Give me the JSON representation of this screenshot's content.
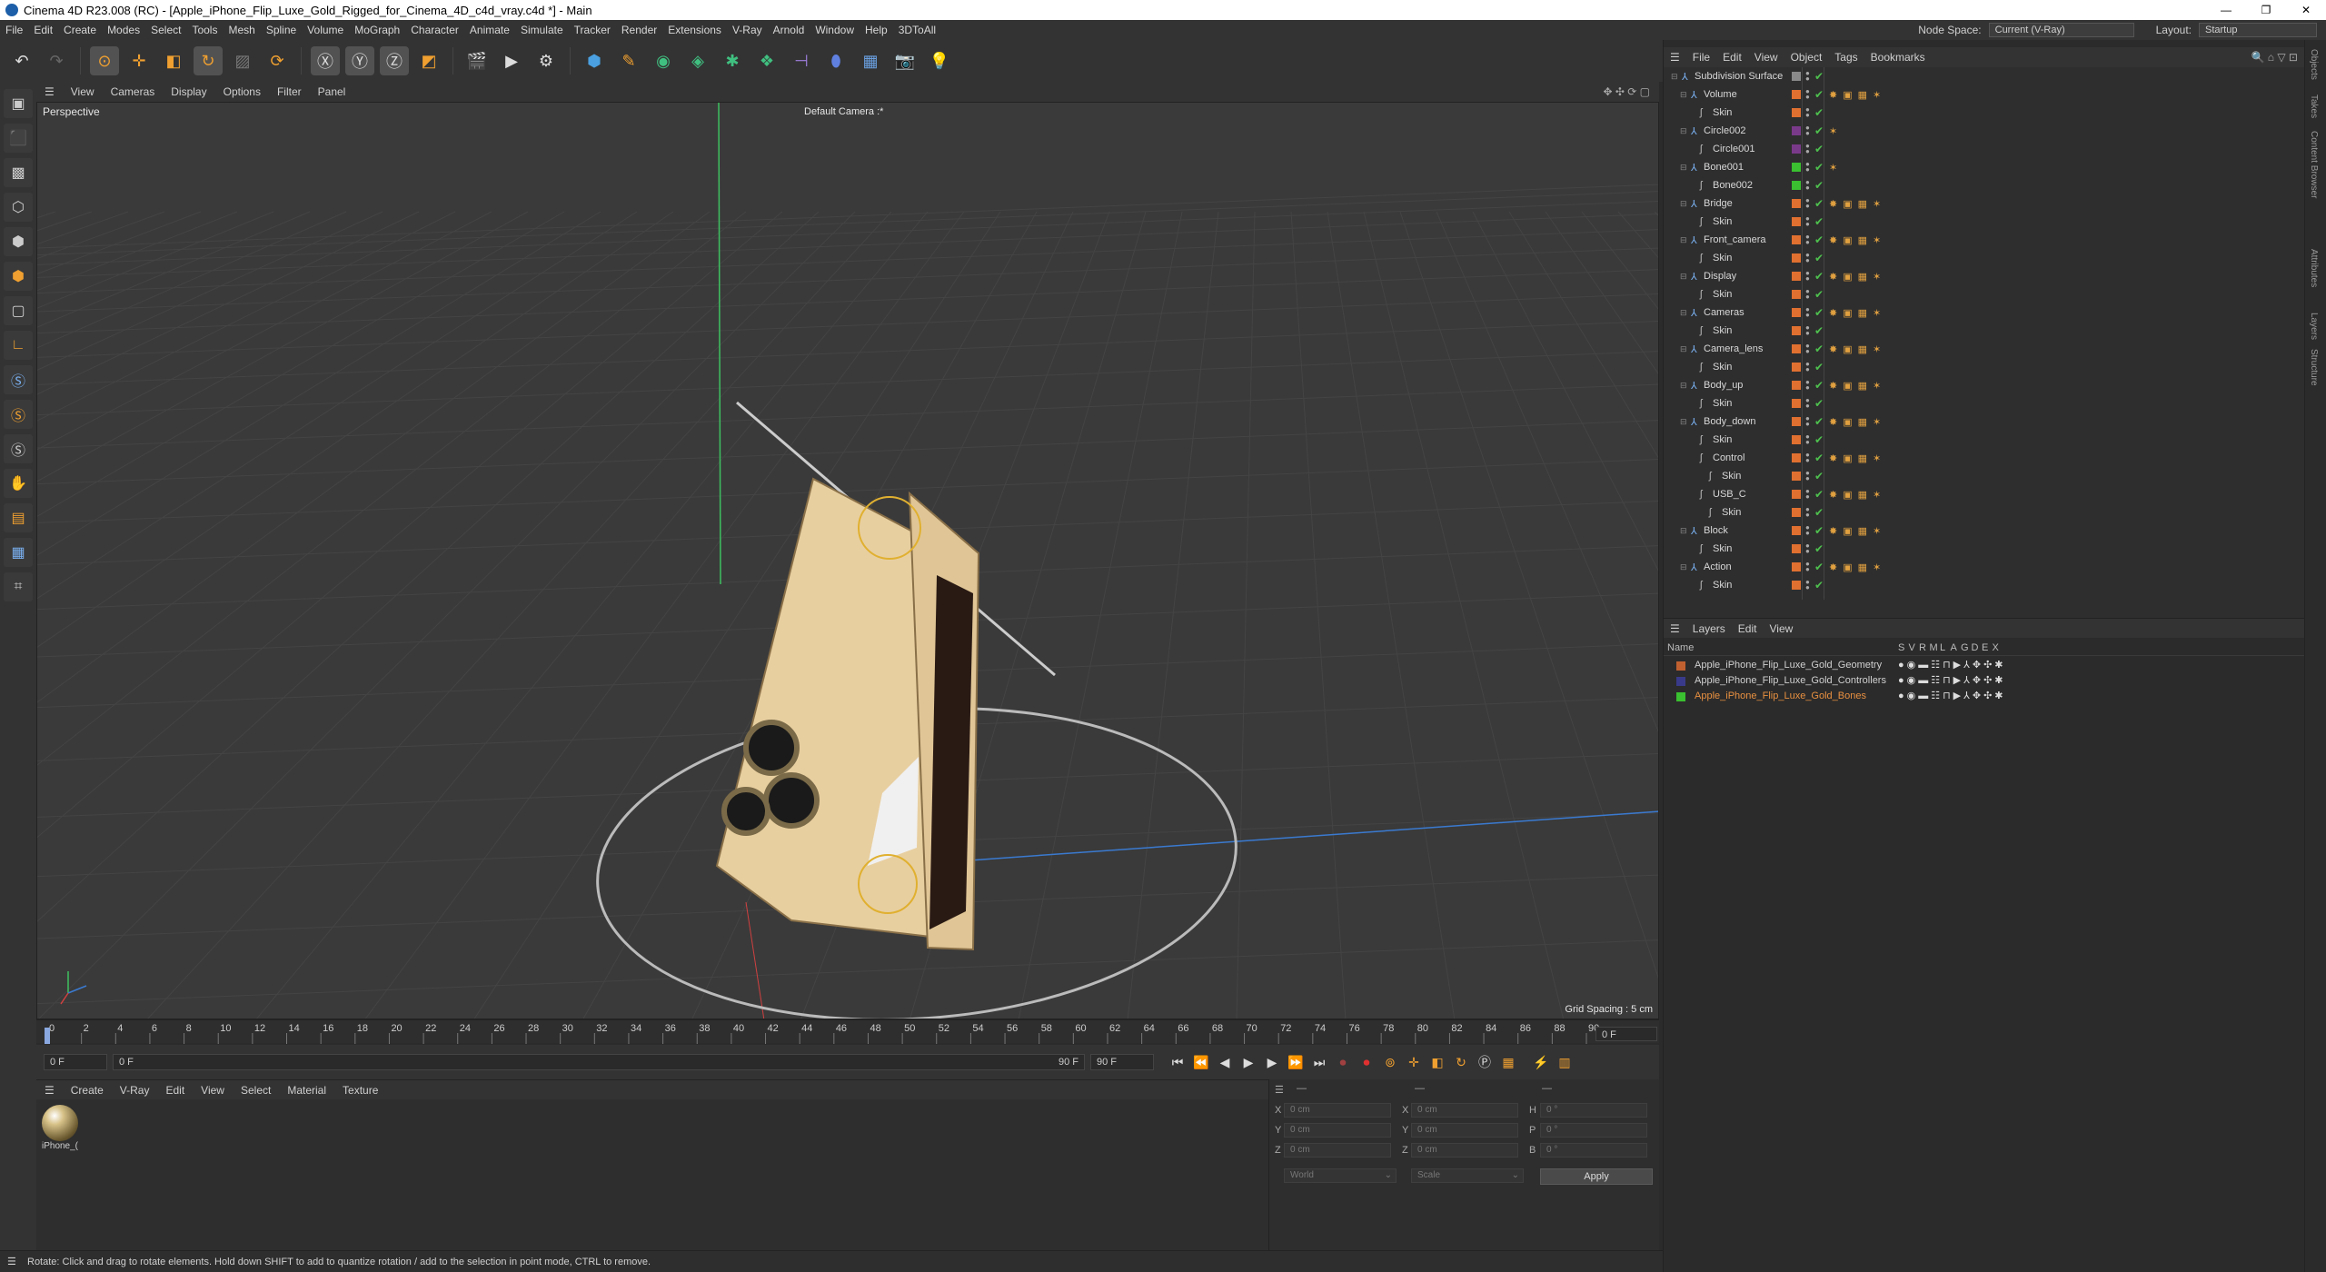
{
  "window": {
    "title": "Cinema 4D R23.008 (RC) - [Apple_iPhone_Flip_Luxe_Gold_Rigged_for_Cinema_4D_c4d_vray.c4d *] - Main",
    "controls": [
      "—",
      "❐",
      "✕"
    ]
  },
  "menubar": {
    "items": [
      "File",
      "Edit",
      "Create",
      "Modes",
      "Select",
      "Tools",
      "Mesh",
      "Spline",
      "Volume",
      "MoGraph",
      "Character",
      "Animate",
      "Simulate",
      "Tracker",
      "Render",
      "Extensions",
      "V-Ray",
      "Arnold",
      "Window",
      "Help",
      "3DToAll"
    ],
    "node_space_label": "Node Space:",
    "node_space_value": "Current (V-Ray)",
    "layout_label": "Layout:",
    "layout_value": "Startup"
  },
  "viewport": {
    "menu": [
      "View",
      "Cameras",
      "Display",
      "Options",
      "Filter",
      "Panel"
    ],
    "projection": "Perspective",
    "camera": "Default Camera :*",
    "grid_spacing": "Grid Spacing : 5 cm"
  },
  "timeline": {
    "ticks": [
      "0",
      "2",
      "4",
      "6",
      "8",
      "10",
      "12",
      "14",
      "16",
      "18",
      "20",
      "22",
      "24",
      "26",
      "28",
      "30",
      "32",
      "34",
      "36",
      "38",
      "40",
      "42",
      "44",
      "46",
      "48",
      "50",
      "52",
      "54",
      "56",
      "58",
      "60",
      "62",
      "64",
      "66",
      "68",
      "70",
      "72",
      "74",
      "76",
      "78",
      "80",
      "82",
      "84",
      "86",
      "88",
      "90"
    ],
    "current_frame": "0 F"
  },
  "transport": {
    "start": "0 F",
    "current": "0 F",
    "end_a": "90 F",
    "end_b": "90 F"
  },
  "materials": {
    "menu": [
      "Create",
      "V-Ray",
      "Edit",
      "View",
      "Select",
      "Material",
      "Texture"
    ],
    "items": [
      {
        "label": "iPhone_("
      }
    ]
  },
  "coords": {
    "header_a": "—",
    "header_b": "—",
    "header_c": "—",
    "rows": [
      {
        "a": "X",
        "av": "0 cm",
        "b": "X",
        "bv": "0 cm",
        "c": "H",
        "cv": "0 °"
      },
      {
        "a": "Y",
        "av": "0 cm",
        "b": "Y",
        "bv": "0 cm",
        "c": "P",
        "cv": "0 °"
      },
      {
        "a": "Z",
        "av": "0 cm",
        "b": "Z",
        "bv": "0 cm",
        "c": "B",
        "cv": "0 °"
      }
    ],
    "world": "World",
    "scale": "Scale",
    "apply": "Apply"
  },
  "status": "Rotate: Click and drag to rotate elements. Hold down SHIFT to add to quantize rotation / add to the selection in point mode, CTRL to remove.",
  "objects": {
    "menu": [
      "File",
      "Edit",
      "View",
      "Object",
      "Tags",
      "Bookmarks"
    ],
    "rows": [
      {
        "name": "Subdivision Surface",
        "indent": 0,
        "tag": "#8a8a8a"
      },
      {
        "name": "Volume",
        "indent": 1,
        "tag": "#e07030"
      },
      {
        "name": "Skin",
        "indent": 2,
        "tag": "#e07030"
      },
      {
        "name": "Circle002",
        "indent": 1,
        "tag": "#7a3a8a"
      },
      {
        "name": "Circle001",
        "indent": 2,
        "tag": "#7a3a8a"
      },
      {
        "name": "Bone001",
        "indent": 1,
        "tag": "#3ac030"
      },
      {
        "name": "Bone002",
        "indent": 2,
        "tag": "#3ac030"
      },
      {
        "name": "Bridge",
        "indent": 1,
        "tag": "#e07030"
      },
      {
        "name": "Skin",
        "indent": 2,
        "tag": "#e07030"
      },
      {
        "name": "Front_camera",
        "indent": 1,
        "tag": "#e07030"
      },
      {
        "name": "Skin",
        "indent": 2,
        "tag": "#e07030"
      },
      {
        "name": "Display",
        "indent": 1,
        "tag": "#e07030"
      },
      {
        "name": "Skin",
        "indent": 2,
        "tag": "#e07030"
      },
      {
        "name": "Cameras",
        "indent": 1,
        "tag": "#e07030"
      },
      {
        "name": "Skin",
        "indent": 2,
        "tag": "#e07030"
      },
      {
        "name": "Camera_lens",
        "indent": 1,
        "tag": "#e07030"
      },
      {
        "name": "Skin",
        "indent": 2,
        "tag": "#e07030"
      },
      {
        "name": "Body_up",
        "indent": 1,
        "tag": "#e07030"
      },
      {
        "name": "Skin",
        "indent": 2,
        "tag": "#e07030"
      },
      {
        "name": "Body_down",
        "indent": 1,
        "tag": "#e07030"
      },
      {
        "name": "Skin",
        "indent": 2,
        "tag": "#e07030"
      },
      {
        "name": "Control",
        "indent": 2,
        "tag": "#e07030"
      },
      {
        "name": "Skin",
        "indent": 3,
        "tag": "#e07030"
      },
      {
        "name": "USB_C",
        "indent": 2,
        "tag": "#e07030"
      },
      {
        "name": "Skin",
        "indent": 3,
        "tag": "#e07030"
      },
      {
        "name": "Block",
        "indent": 1,
        "tag": "#e07030"
      },
      {
        "name": "Skin",
        "indent": 2,
        "tag": "#e07030"
      },
      {
        "name": "Action",
        "indent": 1,
        "tag": "#e07030"
      },
      {
        "name": "Skin",
        "indent": 2,
        "tag": "#e07030"
      }
    ]
  },
  "layers": {
    "menu": [
      "Layers",
      "Edit",
      "View"
    ],
    "header": {
      "name": "Name",
      "cols": [
        "S",
        "V",
        "R",
        "M",
        "L",
        "A",
        "G",
        "D",
        "E",
        "X"
      ]
    },
    "rows": [
      {
        "name": "Apple_iPhone_Flip_Luxe_Gold_Geometry",
        "color": "#c06030",
        "text_color": "#d0d0d0"
      },
      {
        "name": "Apple_iPhone_Flip_Luxe_Gold_Controllers",
        "color": "#3a3a8a",
        "text_color": "#d0d0d0"
      },
      {
        "name": "Apple_iPhone_Flip_Luxe_Gold_Bones",
        "color": "#3ac030",
        "text_color": "#e89040"
      }
    ]
  },
  "sidetabs": [
    "Objects",
    "Takes",
    "Content Browser",
    "Attributes",
    "Layers",
    "Structure"
  ]
}
